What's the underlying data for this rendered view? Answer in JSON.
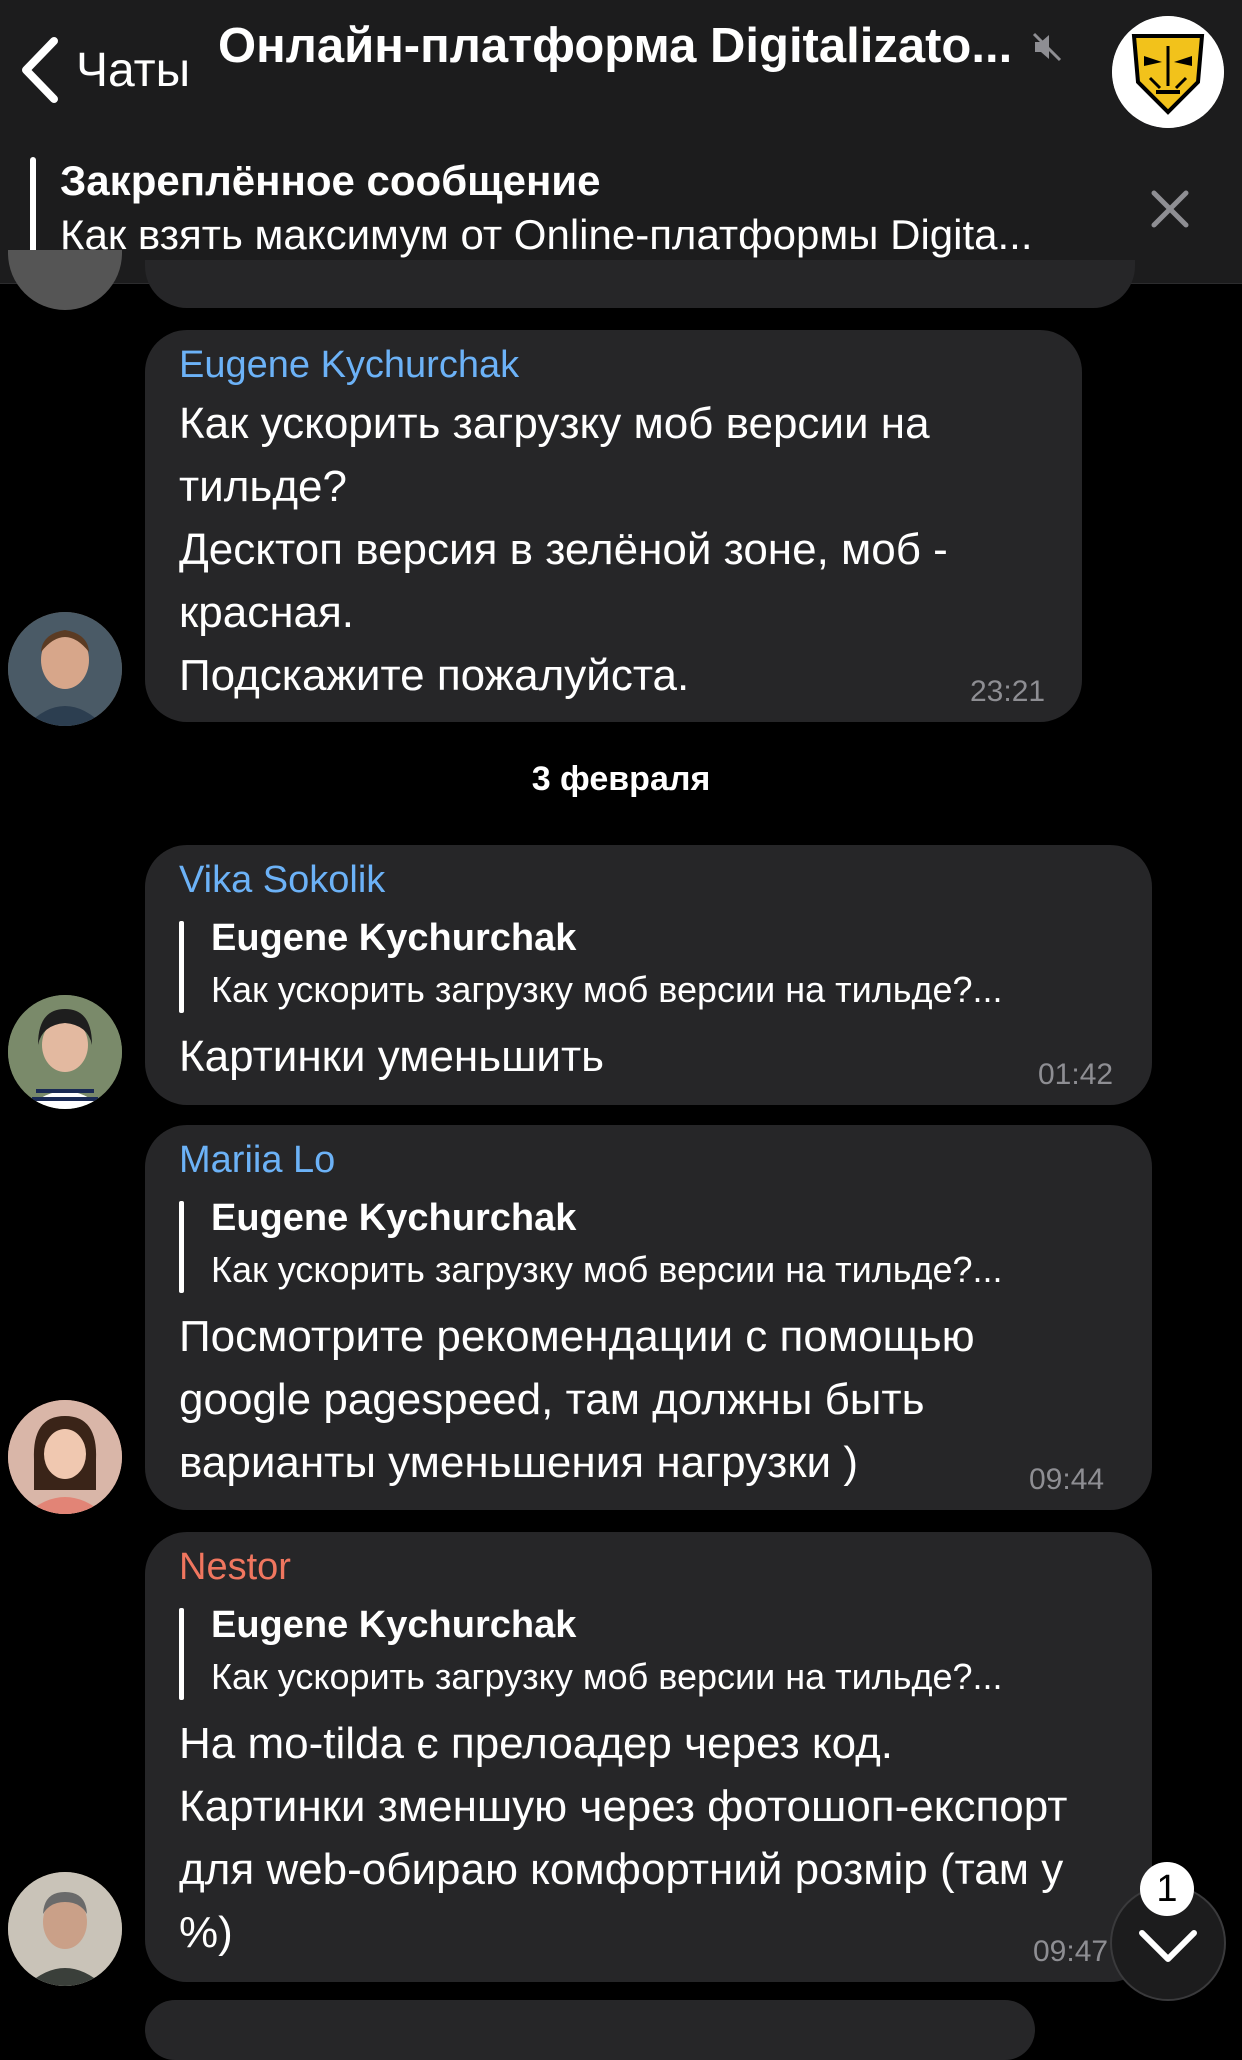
{
  "header": {
    "back_label": "Чаты",
    "title": "Онлайн-платформа Digitalizato...",
    "mute_icon": "muted-speaker-icon",
    "avatar_icon": "mask-logo-icon"
  },
  "pinned": {
    "title": "Закреплённое сообщение",
    "text": "Как взять максимум от Online-платформы Digita..."
  },
  "date_separator": "3 февраля",
  "messages": [
    {
      "sender": "Eugene Kychurchak",
      "sender_color": "#6cb2f7",
      "text": "Как ускорить загрузку моб версии на тильде?\nДесктоп версия в зелёной зоне, моб - красная.\nПодскажите пожалуйста.",
      "time": "23:21"
    },
    {
      "sender": "Vika Sokolik",
      "sender_color": "#6cb2f7",
      "reply_name": "Eugene Kychurchak",
      "reply_text": "Как ускорить загрузку моб версии на тильде?...",
      "text": "Картинки уменьшить",
      "time": "01:42"
    },
    {
      "sender": "Mariia Lo",
      "sender_color": "#6cb2f7",
      "reply_name": "Eugene Kychurchak",
      "reply_text": "Как ускорить загрузку моб версии на тильде?...",
      "text": "Посмотрите рекомендации с помощью google pagespeed, там должны быть варианты уменьшения нагрузки )",
      "time": "09:44"
    },
    {
      "sender": "Nestor",
      "sender_color": "#f0765f",
      "reply_name": "Eugene Kychurchak",
      "reply_text": "Как ускорить загрузку моб версии на тильде?...",
      "text": "На mo-tilda є прелоадер через код. Картинки зменшую через фотошоп-експорт для web-обираю комфортний розмір (там у %)",
      "time": "09:47"
    }
  ],
  "scroll_down": {
    "badge": "1",
    "icon": "chevron-down-icon"
  }
}
